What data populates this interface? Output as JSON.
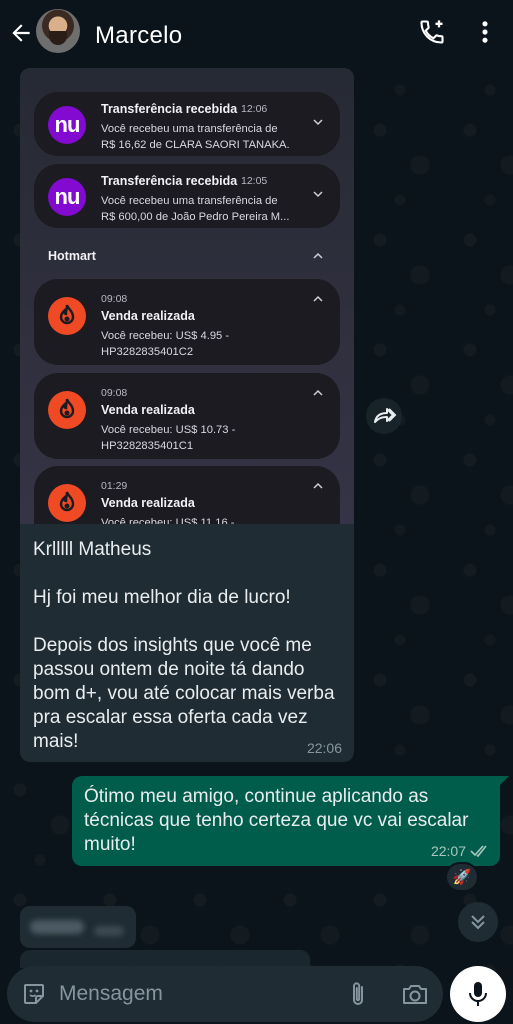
{
  "header": {
    "contact_name": "Marcelo"
  },
  "incoming_message": {
    "screenshot": {
      "notifications": [
        {
          "app": "nubank",
          "logo_text": "nu",
          "title": "Transferência recebida",
          "time": "12:06",
          "body_line1": "Você recebeu uma transferência de",
          "body_line2": "R$ 16,62 de CLARA SAORI TANAKA."
        },
        {
          "app": "nubank",
          "logo_text": "nu",
          "title": "Transferência recebida",
          "time": "12:05",
          "body_line1": "Você recebeu uma transferência de",
          "body_line2": "R$ 600,00 de João Pedro Pereira M..."
        }
      ],
      "group_label": "Hotmart",
      "hotmart_notifications": [
        {
          "time": "09:08",
          "title": "Venda realizada",
          "body_line1": "Você recebeu: US$ 4.95 -",
          "body_line2": "HP3282835401C2"
        },
        {
          "time": "09:08",
          "title": "Venda realizada",
          "body_line1": "Você recebeu: US$ 10.73 -",
          "body_line2": "HP3282835401C1"
        },
        {
          "time": "01:29",
          "title": "Venda realizada",
          "body_line1": "Você recebeu: US$ 11.16 -",
          "body_line2": ""
        }
      ]
    },
    "text": "Krlllll Matheus\n\nHj foi meu melhor dia de lucro!\n\nDepois dos insights que você me passou ontem de noite tá dando bom d+, vou até colocar mais verba pra escalar essa oferta cada vez mais!",
    "time": "22:06"
  },
  "outgoing_message": {
    "text": "Ótimo meu amigo, continue aplicando as técnicas que tenho certeza que vc vai escalar muito!",
    "time": "22:07",
    "reaction": "🚀"
  },
  "input": {
    "placeholder": "Mensagem"
  },
  "colors": {
    "background": "#0b141a",
    "incoming_bubble": "#1f2c34",
    "outgoing_bubble": "#005c4b",
    "nubank": "#820ad1",
    "hotmart": "#ef4a23"
  },
  "icons": [
    "back-arrow-icon",
    "add-call-icon",
    "more-vert-icon",
    "forward-icon",
    "double-check-icon",
    "scroll-down-icon",
    "sticker-icon",
    "attach-icon",
    "camera-icon",
    "mic-icon",
    "chevron-down-icon",
    "chevron-up-icon",
    "hotmart-flame-icon"
  ]
}
